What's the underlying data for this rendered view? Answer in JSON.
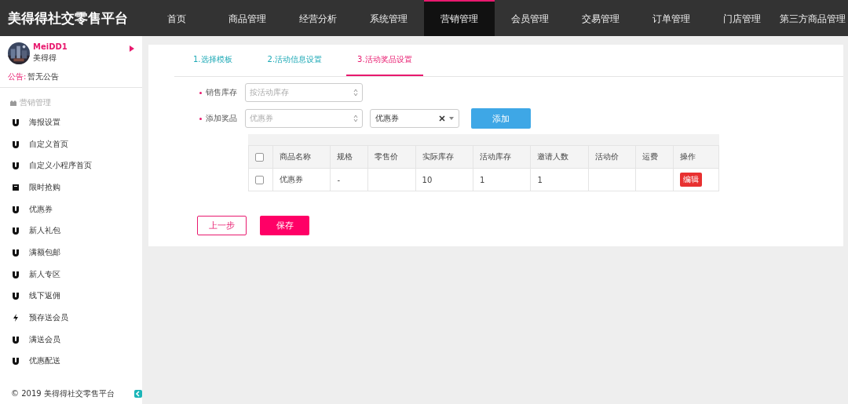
{
  "logo": "美得得社交零售平台",
  "nav": [
    {
      "label": "首页",
      "selected": false
    },
    {
      "label": "商品管理",
      "selected": false
    },
    {
      "label": "经营分析",
      "selected": false
    },
    {
      "label": "系统管理",
      "selected": false
    },
    {
      "label": "营销管理",
      "selected": true
    },
    {
      "label": "会员管理",
      "selected": false
    },
    {
      "label": "交易管理",
      "selected": false
    },
    {
      "label": "订单管理",
      "selected": false
    },
    {
      "label": "门店管理",
      "selected": false
    },
    {
      "label": "第三方商品管理",
      "selected": false
    }
  ],
  "user": {
    "name": "MeiDD1",
    "store": "美得得",
    "notice_label": "公告:",
    "notice": "暂无公告"
  },
  "sidebar": {
    "section": "营销管理",
    "items": [
      {
        "label": "海报设置",
        "kind": "magnet"
      },
      {
        "label": "自定义首页",
        "kind": "magnet"
      },
      {
        "label": "自定义小程序首页",
        "kind": "magnet"
      },
      {
        "label": "限时抢购",
        "kind": "box"
      },
      {
        "label": "优惠券",
        "kind": "magnet"
      },
      {
        "label": "新人礼包",
        "kind": "magnet"
      },
      {
        "label": "满额包邮",
        "kind": "magnet"
      },
      {
        "label": "新人专区",
        "kind": "magnet"
      },
      {
        "label": "线下返佣",
        "kind": "magnet"
      },
      {
        "label": "预存送会员",
        "kind": "bolt"
      },
      {
        "label": "满送会员",
        "kind": "magnet"
      },
      {
        "label": "优惠配送",
        "kind": "magnet"
      }
    ],
    "footer": "© 2019 美得得社交零售平台"
  },
  "steps": [
    {
      "label": "1.选择模板",
      "selected": false
    },
    {
      "label": "2.活动信息设置",
      "selected": false
    },
    {
      "label": "3.活动奖品设置",
      "selected": true
    }
  ],
  "form": {
    "stock_label": "销售库存",
    "stock_placeholder": "按活动库存",
    "prize_label": "添加奖品",
    "prize_placeholder": "优惠券",
    "prize_value": "优惠券",
    "add_button": "添加"
  },
  "table": {
    "columns": [
      "商品名称",
      "规格",
      "零售价",
      "实际库存",
      "活动库存",
      "邀请人数",
      "活动价",
      "运费",
      "操作"
    ],
    "rows": [
      {
        "checked": false,
        "cells": [
          "优惠券",
          "-",
          "",
          "10",
          "1",
          "1",
          "",
          ""
        ],
        "action": "编辑"
      }
    ],
    "header_checked": false
  },
  "buttons": {
    "back": "上一步",
    "save": "保存"
  }
}
